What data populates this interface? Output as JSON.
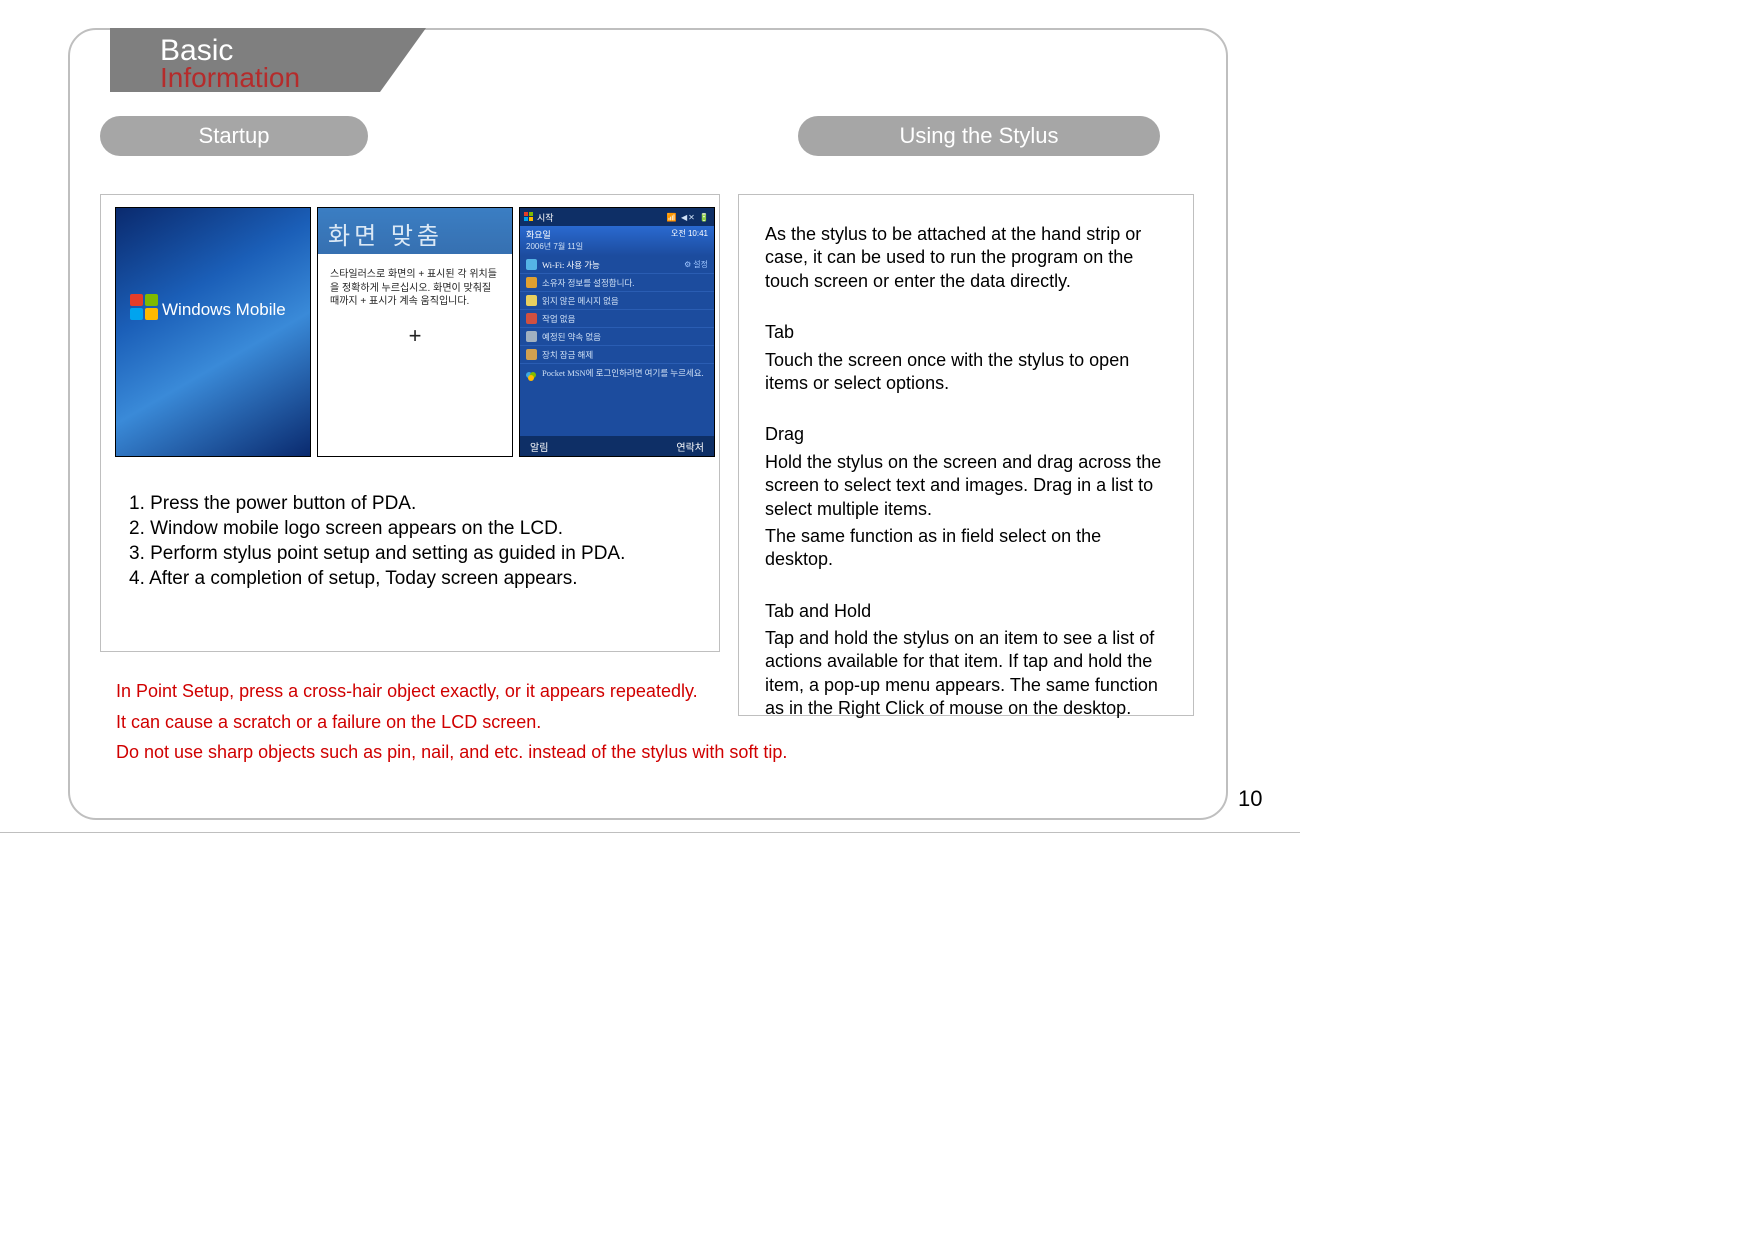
{
  "header": {
    "title_line1": "Basic",
    "title_line2": "Information"
  },
  "pills": {
    "startup": "Startup",
    "stylus": "Using the Stylus"
  },
  "screenshots": {
    "wm_label": "Windows Mobile",
    "align": {
      "title": "화면 맞춤",
      "body": "스타일러스로 화면의 + 표시된 각 위치들을 정확하게 누르십시오.  화면이 맞춰질 때까지 + 표시가 계속 움직입니다.",
      "plus": "+"
    },
    "today": {
      "start": "시작",
      "status_icons": "📶 ◀✕ 🔋",
      "dow": "화요일",
      "date": "2006년 7월 11일",
      "time": "오전 10:41",
      "rows": [
        {
          "icon": "#55b4e6",
          "text": "Wi-Fi: 사용 가능",
          "right": "설정",
          "gear": true,
          "cls": "wifi"
        },
        {
          "icon": "#e0a030",
          "text": "소유자 정보를 설정합니다."
        },
        {
          "icon": "#e8d060",
          "text": "읽지 않은 메시지 없음"
        },
        {
          "icon": "#d05040",
          "text": "작업 없음"
        },
        {
          "icon": "#a0b0c0",
          "text": "예정된 약속 없음"
        },
        {
          "icon": "#d0a050",
          "text": "장치 잠금 해제"
        }
      ],
      "msn": "Pocket MSN에 로그인하려면 여기를 누르세요.",
      "soft_left": "알림",
      "soft_right": "연락처"
    }
  },
  "steps": {
    "s1": "1. Press the power button of PDA.",
    "s2": "2. Window mobile logo screen appears on the LCD.",
    "s3": "3. Perform stylus point setup and setting as guided in PDA.",
    "s4": "4. After a completion of setup, Today screen appears."
  },
  "stylus": {
    "intro": "As the stylus to be attached at the hand strip or case, it can be used to run the program on the touch screen or enter the data directly.",
    "tab_title": "Tab",
    "tab_body": "Touch the screen once with the stylus to open items or select options.",
    "drag_title": "Drag",
    "drag_body1": "Hold the stylus on the screen and drag across the screen to select text and images. Drag in a list to select multiple items.",
    "drag_body2": "The same function as in field select on the desktop.",
    "hold_title": "Tab and Hold",
    "hold_body": "Tap and hold the stylus on an item to see a list of actions available for that item. If tap and hold the item, a pop-up menu appears. The same function as in the Right Click of mouse on the desktop."
  },
  "warnings": {
    "w1": "In Point Setup, press a cross-hair object exactly, or it appears repeatedly.",
    "w2": "It can cause a scratch or a failure on the LCD screen.",
    "w3": "Do not use sharp objects such as pin, nail, and etc. instead of the stylus with soft tip."
  },
  "page_number": "10"
}
